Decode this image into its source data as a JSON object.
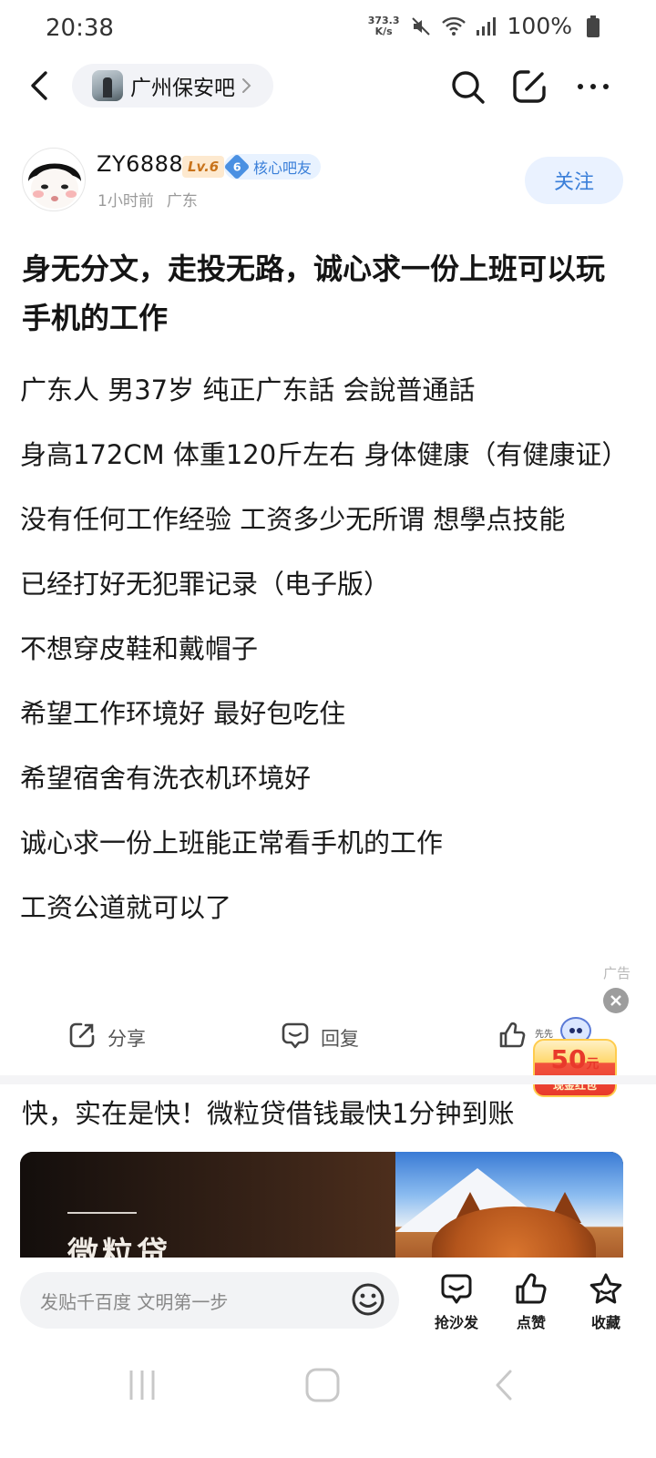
{
  "status_bar": {
    "time": "20:38",
    "net_speed_value": "373.3",
    "net_speed_unit": "K/s",
    "icons": [
      "mute-icon",
      "wifi-icon",
      "signal-icon",
      "battery-icon"
    ],
    "battery": "100%"
  },
  "nav": {
    "forum_name": "广州保安吧"
  },
  "author": {
    "name": "ZY6888",
    "level": "Lv.6",
    "badge_num": "6",
    "badge_label": "核心吧友",
    "time": "1小时前",
    "location": "广东",
    "follow_label": "关注"
  },
  "post": {
    "title": "身无分文，走投无路，诚心求一份上班可以玩手机的工作",
    "lines": [
      "广东人 男37岁 纯正广东話 会說普通話",
      "身高172CM 体重120斤左右 身体健康（有健康证）",
      "没有任何工作经验 工资多少无所谓 想學点技能",
      "已经打好无犯罪记录（电子版）",
      "不想穿皮鞋和戴帽子",
      "希望工作环境好 最好包吃住",
      "希望宿舍有洗衣机环境好",
      "诚心求一份上班能正常看手机的工作",
      "工资公道就可以了"
    ]
  },
  "actions": {
    "share_label": "分享",
    "reply_label": "回复"
  },
  "ad": {
    "label": "广告",
    "red_packet_tag": "先先",
    "red_packet_amount": "50",
    "red_packet_unit": "元",
    "red_packet_label": "现金红包",
    "title": "快，实在是快！微粒贷借钱最快1分钟到账",
    "banner_text": "微粒贷"
  },
  "bottom_bar": {
    "input_placeholder": "发贴千百度 文明第一步",
    "sofa_label": "抢沙发",
    "like_label": "点赞",
    "fav_label": "收藏"
  },
  "colors": {
    "accent_blue": "#3a7fd9",
    "follow_bg": "#eaf2ff",
    "level_orange": "#c8731b",
    "red_packet": "#e8392b"
  }
}
